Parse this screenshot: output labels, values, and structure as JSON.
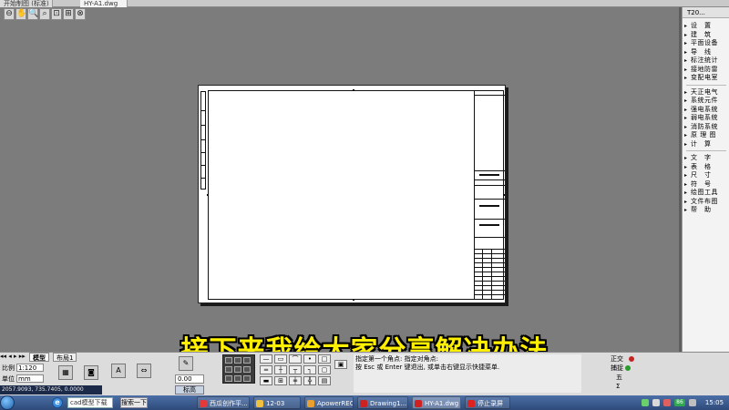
{
  "tabs": [
    {
      "label": "开始制图 (标准)",
      "active": false
    },
    {
      "label": "HY-A1.dwg",
      "active": true
    }
  ],
  "zoom_toolbar": {
    "icons": [
      "zoom-window-icon",
      "pan-icon",
      "zoom-realtime-icon",
      "zoom-previous-icon",
      "zoom-extents-icon",
      "zoom-all-icon",
      "zoom-scale-icon",
      "close-drawing-icon"
    ],
    "glyphs": [
      "⊖",
      "✋",
      "🔍",
      "⌕",
      "⊡",
      "⊞",
      "⊟",
      "⊗"
    ]
  },
  "right_panel": {
    "title": "T20...",
    "items": [
      "设　置",
      "建　筑",
      "平面设备",
      "导　线",
      "标注统计",
      "接地防雷",
      "变配电室",
      "天正电气",
      "系统元件",
      "强电系统",
      "弱电系统",
      "消防系统",
      "原 理 图",
      "计　算",
      "文　字",
      "表　格",
      "尺　寸",
      "符　号",
      "绘图工具",
      "文件布图",
      "帮　助"
    ]
  },
  "caption": "接下来我给大家分享解决办法",
  "bottom": {
    "model_tabs": [
      "模型",
      "布局1"
    ],
    "scale_label": "比例",
    "scale_value": "1:120",
    "units_label": "单位",
    "units_value": "mm",
    "coords": "2057.9093, 735.7405, 0.0000",
    "value_box": "0.00",
    "layer_button": "标高",
    "command_lines": [
      "指定第一个角点: 指定对角点:",
      "按 Esc 或 Enter 键退出, 或单击右键显示快捷菜单."
    ],
    "ortho_label": "正交",
    "snap_label": "捕捉",
    "ortho_sub": [
      "五",
      "Σ"
    ]
  },
  "taskbar": {
    "search_placeholder": "cad模型下载",
    "search_button": "搜索一下",
    "items": [
      {
        "label": "西瓜创作平...",
        "color": "#e23a3a",
        "active": false
      },
      {
        "label": "12-03",
        "color": "#f0c040",
        "active": false
      },
      {
        "label": "ApowerREC",
        "color": "#e8a030",
        "active": false
      },
      {
        "label": "Drawing1...",
        "color": "#cc2222",
        "active": false
      },
      {
        "label": "HY-A1.dwg",
        "color": "#cc2222",
        "active": true
      },
      {
        "label": "停止录屏",
        "color": "#dd2222",
        "active": false
      }
    ],
    "clock": "15:05",
    "tray_badge": "86"
  }
}
